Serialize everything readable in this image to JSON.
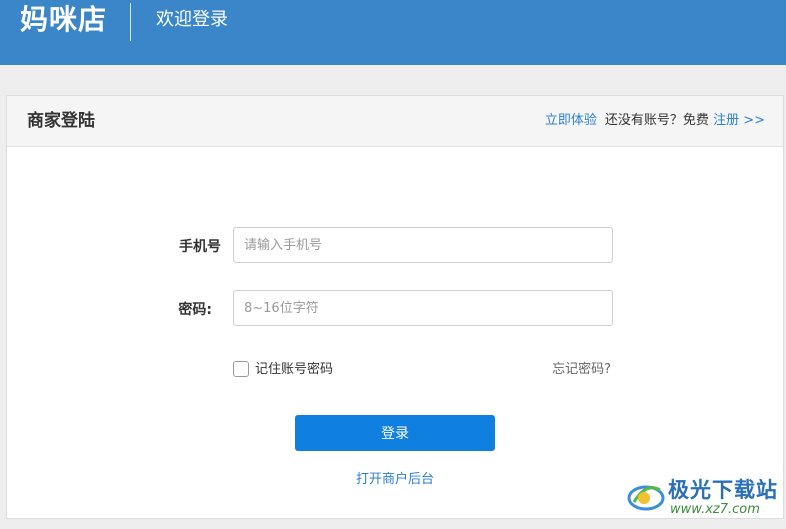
{
  "header": {
    "brand": "妈咪店",
    "subtitle": "欢迎登录"
  },
  "panel": {
    "title": "商家登陆",
    "try_now": "立即体验",
    "no_account_prefix": "还没有账号？免费",
    "register_link": "注册 >>"
  },
  "form": {
    "phone_label": "手机号",
    "phone_placeholder": "请输入手机号",
    "phone_value": "",
    "password_label": "密码:",
    "password_placeholder": "8~16位字符",
    "password_value": "",
    "remember_label": "记住账号密码",
    "remember_checked": false,
    "forgot_label": "忘记密码?",
    "login_button": "登录",
    "open_backend": "打开商户后台"
  },
  "watermark": {
    "title": "极光下载站",
    "url": "www.xz7.com"
  },
  "colors": {
    "header_bg": "#3a86c8",
    "link": "#2b7fd6",
    "primary_button": "#0f7fe0"
  }
}
